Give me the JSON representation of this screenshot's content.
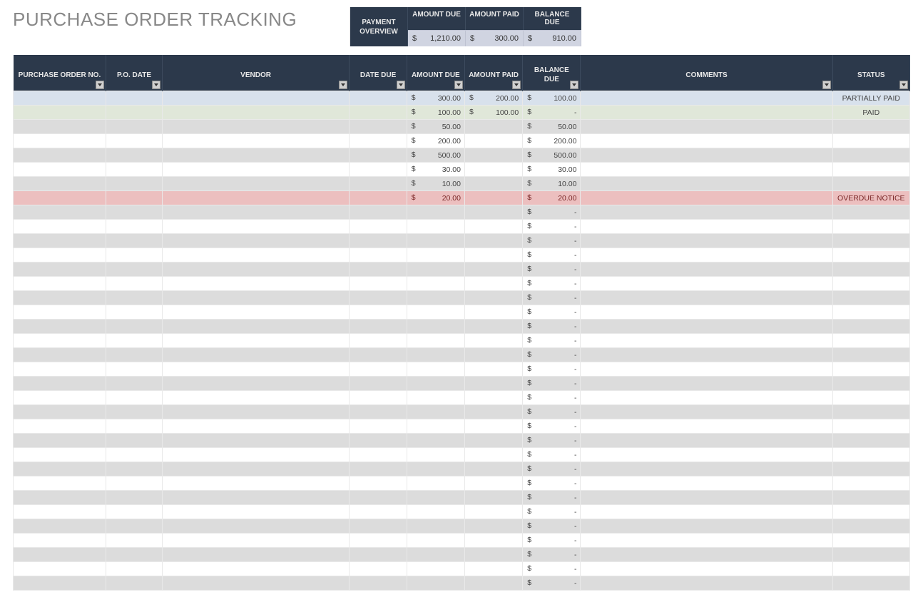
{
  "title": "PURCHASE ORDER TRACKING",
  "overview": {
    "label": "PAYMENT OVERVIEW",
    "amount_due_label": "AMOUNT DUE",
    "amount_paid_label": "AMOUNT PAID",
    "balance_due_label": "BALANCE DUE",
    "currency": "$",
    "amount_due_value": "1,210.00",
    "amount_paid_value": "300.00",
    "balance_due_value": "910.00"
  },
  "columns": {
    "po_no": "PURCHASE ORDER NO.",
    "po_date": "P.O. DATE",
    "vendor": "VENDOR",
    "date_due": "DATE DUE",
    "amount_due": "AMOUNT DUE",
    "amount_paid": "AMOUNT PAID",
    "balance_due": "BALANCE DUE",
    "comments": "COMMENTS",
    "status": "STATUS"
  },
  "currency_symbol": "$",
  "dash": "-",
  "rows": [
    {
      "type": "partial",
      "amount_due": "300.00",
      "amount_paid": "200.00",
      "balance_due": "100.00",
      "status": "PARTIALLY PAID"
    },
    {
      "type": "paid",
      "amount_due": "100.00",
      "amount_paid": "100.00",
      "balance_due": "-",
      "status": "PAID"
    },
    {
      "type": "alt",
      "amount_due": "50.00",
      "amount_paid": "",
      "balance_due": "50.00",
      "status": ""
    },
    {
      "type": "",
      "amount_due": "200.00",
      "amount_paid": "",
      "balance_due": "200.00",
      "status": ""
    },
    {
      "type": "alt",
      "amount_due": "500.00",
      "amount_paid": "",
      "balance_due": "500.00",
      "status": ""
    },
    {
      "type": "",
      "amount_due": "30.00",
      "amount_paid": "",
      "balance_due": "30.00",
      "status": ""
    },
    {
      "type": "alt",
      "amount_due": "10.00",
      "amount_paid": "",
      "balance_due": "10.00",
      "status": ""
    },
    {
      "type": "overdue",
      "amount_due": "20.00",
      "amount_paid": "",
      "balance_due": "20.00",
      "status": "OVERDUE NOTICE"
    },
    {
      "type": "alt",
      "amount_due": "",
      "amount_paid": "",
      "balance_due": "-",
      "status": ""
    },
    {
      "type": "",
      "amount_due": "",
      "amount_paid": "",
      "balance_due": "-",
      "status": ""
    },
    {
      "type": "alt",
      "amount_due": "",
      "amount_paid": "",
      "balance_due": "-",
      "status": ""
    },
    {
      "type": "",
      "amount_due": "",
      "amount_paid": "",
      "balance_due": "-",
      "status": ""
    },
    {
      "type": "alt",
      "amount_due": "",
      "amount_paid": "",
      "balance_due": "-",
      "status": ""
    },
    {
      "type": "",
      "amount_due": "",
      "amount_paid": "",
      "balance_due": "-",
      "status": ""
    },
    {
      "type": "alt",
      "amount_due": "",
      "amount_paid": "",
      "balance_due": "-",
      "status": ""
    },
    {
      "type": "",
      "amount_due": "",
      "amount_paid": "",
      "balance_due": "-",
      "status": ""
    },
    {
      "type": "alt",
      "amount_due": "",
      "amount_paid": "",
      "balance_due": "-",
      "status": ""
    },
    {
      "type": "",
      "amount_due": "",
      "amount_paid": "",
      "balance_due": "-",
      "status": ""
    },
    {
      "type": "alt",
      "amount_due": "",
      "amount_paid": "",
      "balance_due": "-",
      "status": ""
    },
    {
      "type": "",
      "amount_due": "",
      "amount_paid": "",
      "balance_due": "-",
      "status": ""
    },
    {
      "type": "alt",
      "amount_due": "",
      "amount_paid": "",
      "balance_due": "-",
      "status": ""
    },
    {
      "type": "",
      "amount_due": "",
      "amount_paid": "",
      "balance_due": "-",
      "status": ""
    },
    {
      "type": "alt",
      "amount_due": "",
      "amount_paid": "",
      "balance_due": "-",
      "status": ""
    },
    {
      "type": "",
      "amount_due": "",
      "amount_paid": "",
      "balance_due": "-",
      "status": ""
    },
    {
      "type": "alt",
      "amount_due": "",
      "amount_paid": "",
      "balance_due": "-",
      "status": ""
    },
    {
      "type": "",
      "amount_due": "",
      "amount_paid": "",
      "balance_due": "-",
      "status": ""
    },
    {
      "type": "alt",
      "amount_due": "",
      "amount_paid": "",
      "balance_due": "-",
      "status": ""
    },
    {
      "type": "",
      "amount_due": "",
      "amount_paid": "",
      "balance_due": "-",
      "status": ""
    },
    {
      "type": "alt",
      "amount_due": "",
      "amount_paid": "",
      "balance_due": "-",
      "status": ""
    },
    {
      "type": "",
      "amount_due": "",
      "amount_paid": "",
      "balance_due": "-",
      "status": ""
    },
    {
      "type": "alt",
      "amount_due": "",
      "amount_paid": "",
      "balance_due": "-",
      "status": ""
    },
    {
      "type": "",
      "amount_due": "",
      "amount_paid": "",
      "balance_due": "-",
      "status": ""
    },
    {
      "type": "alt",
      "amount_due": "",
      "amount_paid": "",
      "balance_due": "-",
      "status": ""
    },
    {
      "type": "",
      "amount_due": "",
      "amount_paid": "",
      "balance_due": "-",
      "status": ""
    },
    {
      "type": "alt",
      "amount_due": "",
      "amount_paid": "",
      "balance_due": "-",
      "status": ""
    }
  ]
}
